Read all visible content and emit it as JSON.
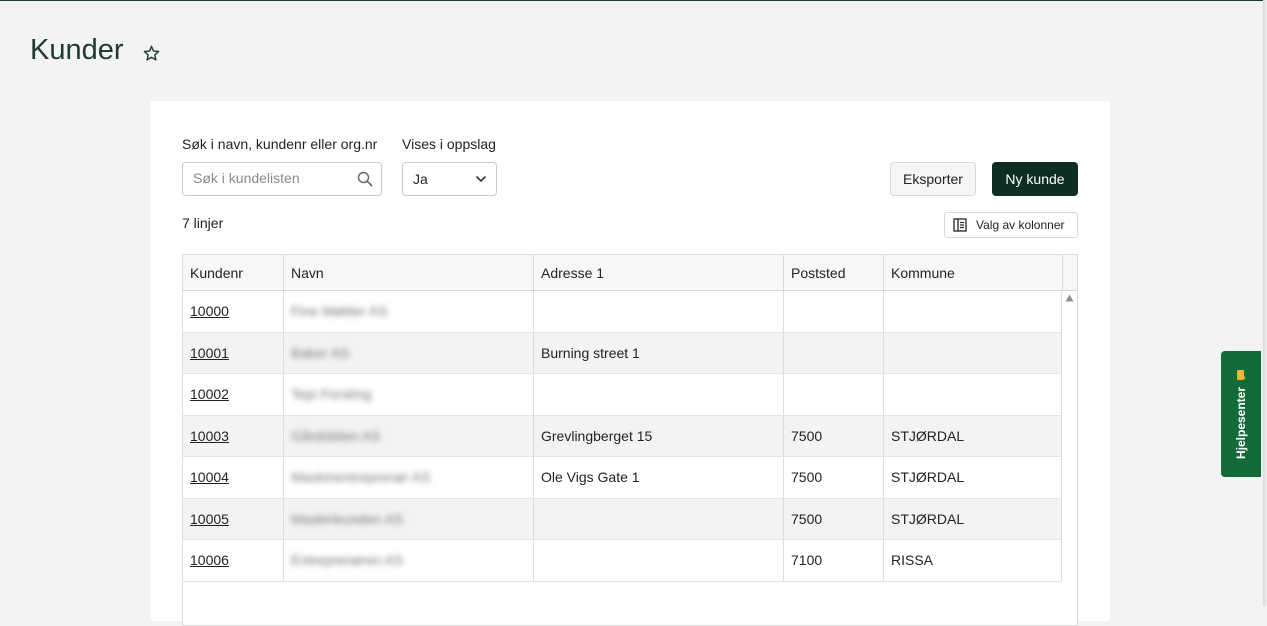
{
  "page": {
    "title": "Kunder"
  },
  "search": {
    "label": "Søk i navn, kundenr eller org.nr",
    "placeholder": "Søk i kundelisten",
    "value": ""
  },
  "filter": {
    "label": "Vises i oppslag",
    "value": "Ja"
  },
  "actions": {
    "export_label": "Eksporter",
    "new_label": "Ny kunde",
    "columns_label": "Valg av kolonner"
  },
  "table": {
    "row_count": "7 linjer",
    "columns": [
      "Kundenr",
      "Navn",
      "Adresse 1",
      "Poststed",
      "Kommune"
    ],
    "rows": [
      {
        "kundenr": "10000",
        "navn": "Fine Møbler AS",
        "adresse": "",
        "poststed": "",
        "kommune": ""
      },
      {
        "kundenr": "10001",
        "navn": "Baker AS",
        "adresse": "Burning street 1",
        "poststed": "",
        "kommune": ""
      },
      {
        "kundenr": "10002",
        "navn": "Tepi Forsting",
        "adresse": "",
        "poststed": "",
        "kommune": ""
      },
      {
        "kundenr": "10003",
        "navn": "Gårdsbilen AS",
        "adresse": "Grevlingberget 15",
        "poststed": "7500",
        "kommune": "STJØRDAL"
      },
      {
        "kundenr": "10004",
        "navn": "Maskinentreprenør AS",
        "adresse": "Ole Vigs Gate 1",
        "poststed": "7500",
        "kommune": "STJØRDAL"
      },
      {
        "kundenr": "10005",
        "navn": "Maskinkunden AS",
        "adresse": "",
        "poststed": "7500",
        "kommune": "STJØRDAL"
      },
      {
        "kundenr": "10006",
        "navn": "Entreprenøren AS",
        "adresse": "",
        "poststed": "7100",
        "kommune": "RISSA"
      }
    ]
  },
  "help": {
    "label": "Hjelpesenter"
  },
  "colors": {
    "primary": "#0f2d22",
    "help_tab": "#136b3a",
    "title": "#1f3a30"
  },
  "icons": {
    "favorite": "star-icon",
    "search": "search-icon",
    "dropdown": "chevron-down-icon",
    "columns": "columns-icon",
    "help": "chat-icon"
  }
}
